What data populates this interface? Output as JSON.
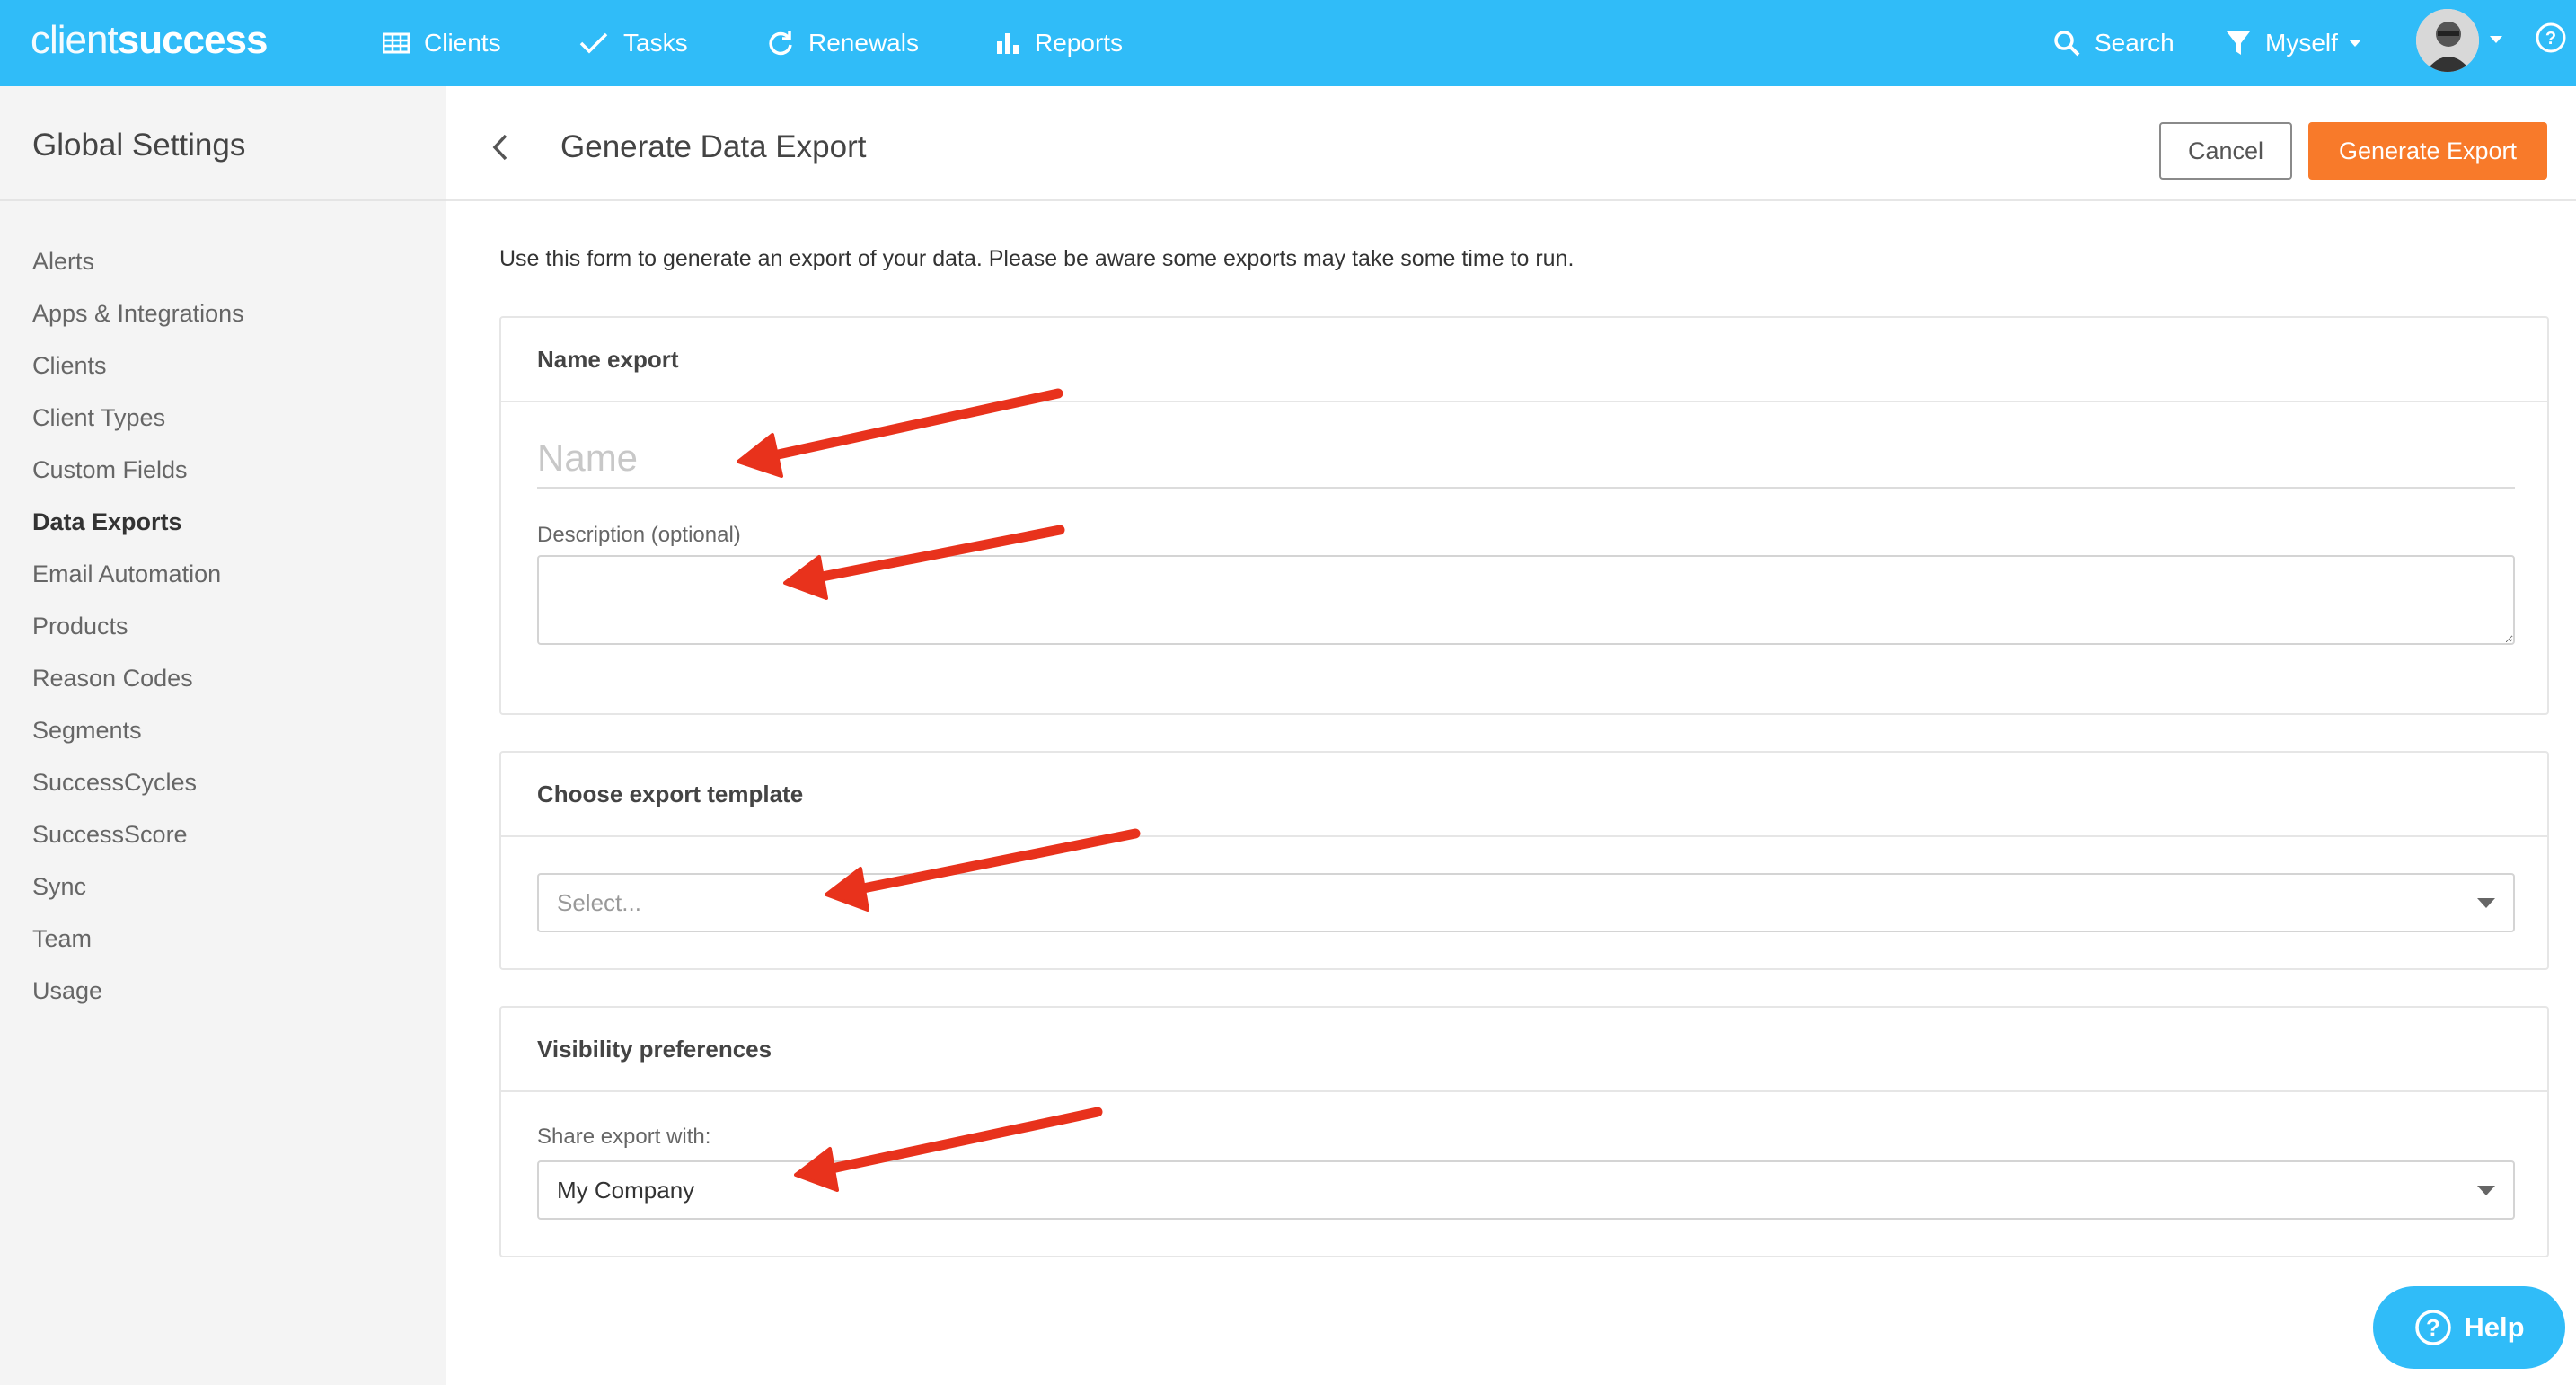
{
  "brand": {
    "part1": "client",
    "part2": "success"
  },
  "nav": {
    "items": [
      {
        "label": "Clients",
        "icon": "table-icon"
      },
      {
        "label": "Tasks",
        "icon": "check-icon"
      },
      {
        "label": "Renewals",
        "icon": "refresh-icon"
      },
      {
        "label": "Reports",
        "icon": "bar-chart-icon"
      }
    ],
    "search_label": "Search",
    "filter_label": "Myself"
  },
  "sidebar": {
    "title": "Global Settings",
    "items": [
      {
        "label": "Alerts"
      },
      {
        "label": "Apps & Integrations"
      },
      {
        "label": "Clients"
      },
      {
        "label": "Client Types"
      },
      {
        "label": "Custom Fields"
      },
      {
        "label": "Data Exports",
        "active": true
      },
      {
        "label": "Email Automation"
      },
      {
        "label": "Products"
      },
      {
        "label": "Reason Codes"
      },
      {
        "label": "Segments"
      },
      {
        "label": "SuccessCycles"
      },
      {
        "label": "SuccessScore"
      },
      {
        "label": "Sync"
      },
      {
        "label": "Team"
      },
      {
        "label": "Usage"
      }
    ]
  },
  "header": {
    "title": "Generate Data Export",
    "cancel_label": "Cancel",
    "generate_label": "Generate Export"
  },
  "intro_text": "Use this form to generate an export of your data. Please be aware some exports may take some time to run.",
  "name_panel": {
    "heading": "Name export",
    "name_placeholder": "Name",
    "name_value": "",
    "description_label": "Description (optional)",
    "description_value": ""
  },
  "template_panel": {
    "heading": "Choose export template",
    "placeholder": "Select..."
  },
  "visibility_panel": {
    "heading": "Visibility preferences",
    "share_label": "Share export with:",
    "share_value": "My Company"
  },
  "help_label": "Help",
  "colors": {
    "topbar": "#30bcf8",
    "primary_button": "#f87a2a",
    "annotation_arrow": "#e8321c"
  }
}
